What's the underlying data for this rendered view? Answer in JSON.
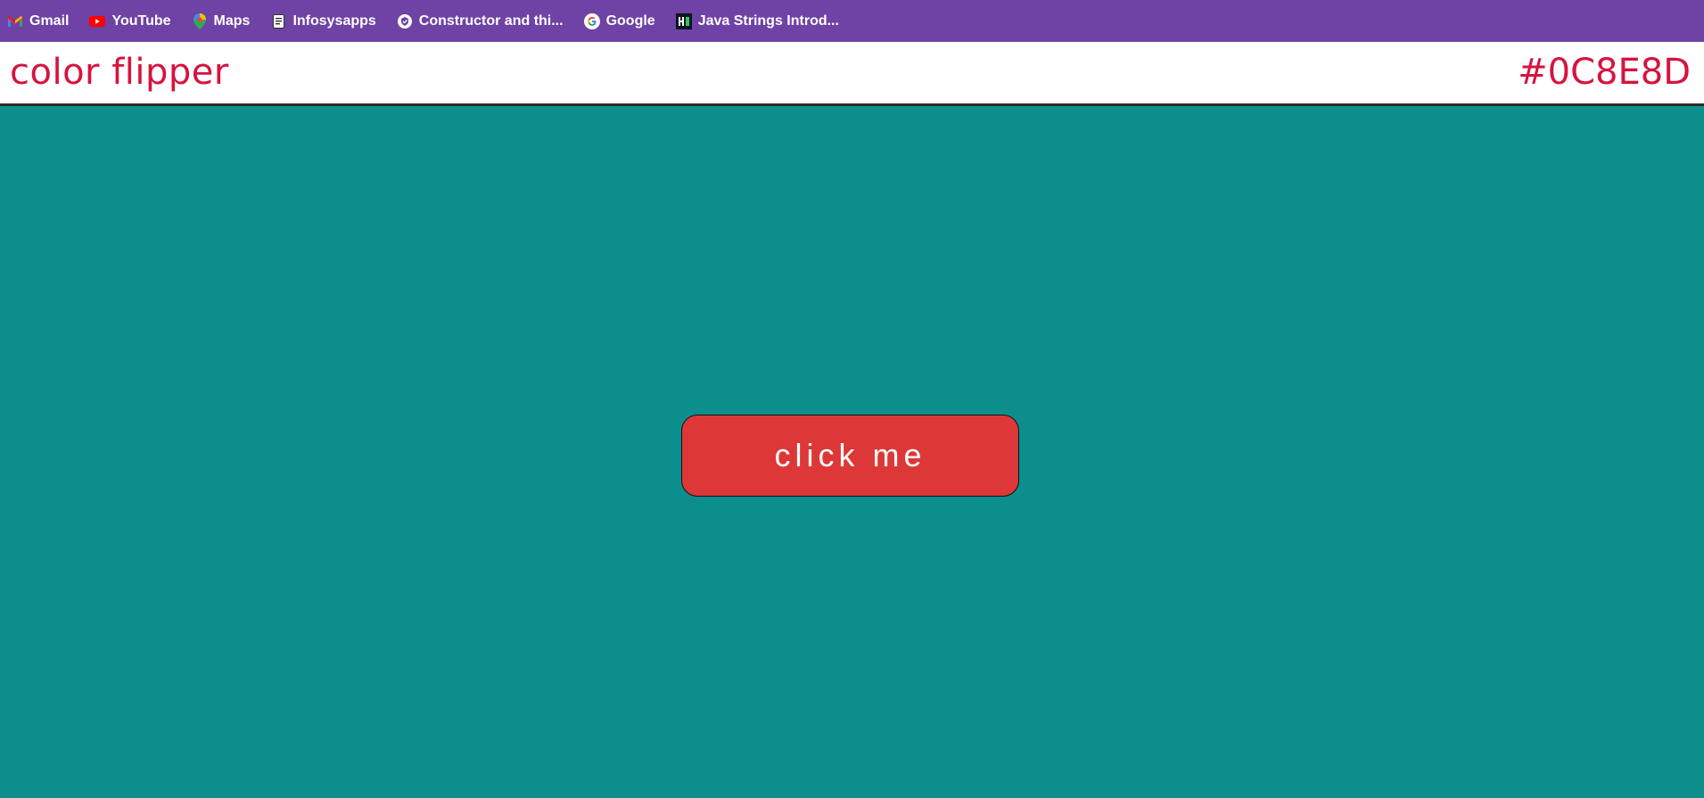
{
  "browser": {
    "bookmarks": [
      {
        "label": "Gmail",
        "icon": "gmail-icon"
      },
      {
        "label": "YouTube",
        "icon": "youtube-icon"
      },
      {
        "label": "Maps",
        "icon": "maps-icon"
      },
      {
        "label": "Infosysapps",
        "icon": "document-icon"
      },
      {
        "label": "Constructor and thi...",
        "icon": "shield-icon"
      },
      {
        "label": "Google",
        "icon": "google-icon"
      },
      {
        "label": "Java Strings Introd...",
        "icon": "hackerrank-icon"
      }
    ],
    "bar_color": "#6f42a5"
  },
  "header": {
    "title": "color flipper",
    "color_code": "#0C8E8D",
    "text_color": "#d6133f"
  },
  "main": {
    "background_color": "#0C8E8D",
    "button_label": "click me",
    "button_color": "#dd3737"
  }
}
